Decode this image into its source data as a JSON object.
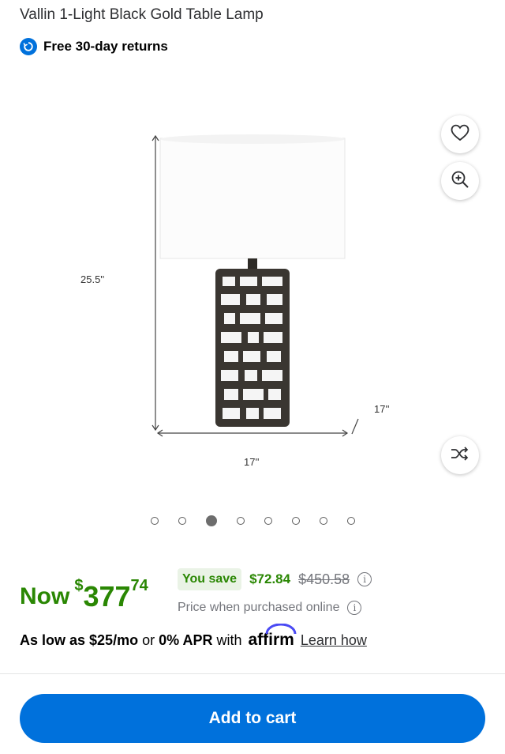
{
  "product": {
    "title": "Vallin 1-Light Black Gold Table Lamp",
    "returns_label": "Free 30-day returns"
  },
  "image": {
    "height_label": "25.5''",
    "width_label": "17''",
    "depth_label": "17''",
    "carousel_count": 8,
    "active_index": 2
  },
  "price": {
    "now_label": "Now",
    "currency": "$",
    "dollars": "377",
    "cents": "74",
    "save_label": "You save",
    "save_amount": "$72.84",
    "was_price": "$450.58",
    "online_note": "Price when purchased online"
  },
  "financing": {
    "as_low": "As low as $25/mo",
    "or": "or",
    "apr": "0% APR",
    "with": "with",
    "brand": "affirm",
    "learn": "Learn how"
  },
  "cta": {
    "add_to_cart": "Add to cart"
  },
  "colors": {
    "brand_blue": "#0071dc",
    "price_green": "#2a8703",
    "save_bg": "#eaf3e6"
  },
  "icons": [
    "returns-icon",
    "heart-icon",
    "zoom-in-icon",
    "shuffle-icon",
    "info-icon"
  ]
}
